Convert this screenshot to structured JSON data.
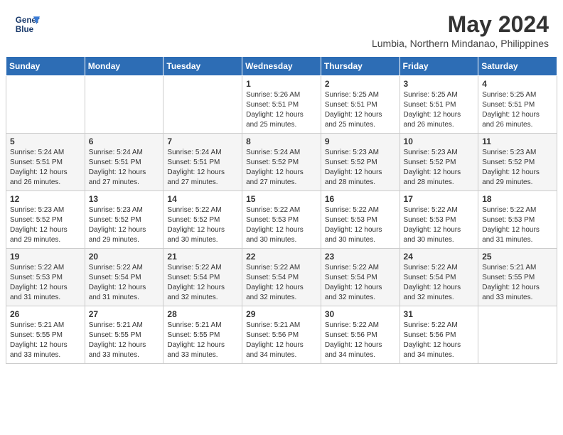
{
  "header": {
    "logo_line1": "General",
    "logo_line2": "Blue",
    "month": "May 2024",
    "location": "Lumbia, Northern Mindanao, Philippines"
  },
  "weekdays": [
    "Sunday",
    "Monday",
    "Tuesday",
    "Wednesday",
    "Thursday",
    "Friday",
    "Saturday"
  ],
  "weeks": [
    [
      {
        "day": "",
        "sunrise": "",
        "sunset": "",
        "daylight": ""
      },
      {
        "day": "",
        "sunrise": "",
        "sunset": "",
        "daylight": ""
      },
      {
        "day": "",
        "sunrise": "",
        "sunset": "",
        "daylight": ""
      },
      {
        "day": "1",
        "sunrise": "Sunrise: 5:26 AM",
        "sunset": "Sunset: 5:51 PM",
        "daylight": "Daylight: 12 hours and 25 minutes."
      },
      {
        "day": "2",
        "sunrise": "Sunrise: 5:25 AM",
        "sunset": "Sunset: 5:51 PM",
        "daylight": "Daylight: 12 hours and 25 minutes."
      },
      {
        "day": "3",
        "sunrise": "Sunrise: 5:25 AM",
        "sunset": "Sunset: 5:51 PM",
        "daylight": "Daylight: 12 hours and 26 minutes."
      },
      {
        "day": "4",
        "sunrise": "Sunrise: 5:25 AM",
        "sunset": "Sunset: 5:51 PM",
        "daylight": "Daylight: 12 hours and 26 minutes."
      }
    ],
    [
      {
        "day": "5",
        "sunrise": "Sunrise: 5:24 AM",
        "sunset": "Sunset: 5:51 PM",
        "daylight": "Daylight: 12 hours and 26 minutes."
      },
      {
        "day": "6",
        "sunrise": "Sunrise: 5:24 AM",
        "sunset": "Sunset: 5:51 PM",
        "daylight": "Daylight: 12 hours and 27 minutes."
      },
      {
        "day": "7",
        "sunrise": "Sunrise: 5:24 AM",
        "sunset": "Sunset: 5:51 PM",
        "daylight": "Daylight: 12 hours and 27 minutes."
      },
      {
        "day": "8",
        "sunrise": "Sunrise: 5:24 AM",
        "sunset": "Sunset: 5:52 PM",
        "daylight": "Daylight: 12 hours and 27 minutes."
      },
      {
        "day": "9",
        "sunrise": "Sunrise: 5:23 AM",
        "sunset": "Sunset: 5:52 PM",
        "daylight": "Daylight: 12 hours and 28 minutes."
      },
      {
        "day": "10",
        "sunrise": "Sunrise: 5:23 AM",
        "sunset": "Sunset: 5:52 PM",
        "daylight": "Daylight: 12 hours and 28 minutes."
      },
      {
        "day": "11",
        "sunrise": "Sunrise: 5:23 AM",
        "sunset": "Sunset: 5:52 PM",
        "daylight": "Daylight: 12 hours and 29 minutes."
      }
    ],
    [
      {
        "day": "12",
        "sunrise": "Sunrise: 5:23 AM",
        "sunset": "Sunset: 5:52 PM",
        "daylight": "Daylight: 12 hours and 29 minutes."
      },
      {
        "day": "13",
        "sunrise": "Sunrise: 5:23 AM",
        "sunset": "Sunset: 5:52 PM",
        "daylight": "Daylight: 12 hours and 29 minutes."
      },
      {
        "day": "14",
        "sunrise": "Sunrise: 5:22 AM",
        "sunset": "Sunset: 5:52 PM",
        "daylight": "Daylight: 12 hours and 30 minutes."
      },
      {
        "day": "15",
        "sunrise": "Sunrise: 5:22 AM",
        "sunset": "Sunset: 5:53 PM",
        "daylight": "Daylight: 12 hours and 30 minutes."
      },
      {
        "day": "16",
        "sunrise": "Sunrise: 5:22 AM",
        "sunset": "Sunset: 5:53 PM",
        "daylight": "Daylight: 12 hours and 30 minutes."
      },
      {
        "day": "17",
        "sunrise": "Sunrise: 5:22 AM",
        "sunset": "Sunset: 5:53 PM",
        "daylight": "Daylight: 12 hours and 30 minutes."
      },
      {
        "day": "18",
        "sunrise": "Sunrise: 5:22 AM",
        "sunset": "Sunset: 5:53 PM",
        "daylight": "Daylight: 12 hours and 31 minutes."
      }
    ],
    [
      {
        "day": "19",
        "sunrise": "Sunrise: 5:22 AM",
        "sunset": "Sunset: 5:53 PM",
        "daylight": "Daylight: 12 hours and 31 minutes."
      },
      {
        "day": "20",
        "sunrise": "Sunrise: 5:22 AM",
        "sunset": "Sunset: 5:54 PM",
        "daylight": "Daylight: 12 hours and 31 minutes."
      },
      {
        "day": "21",
        "sunrise": "Sunrise: 5:22 AM",
        "sunset": "Sunset: 5:54 PM",
        "daylight": "Daylight: 12 hours and 32 minutes."
      },
      {
        "day": "22",
        "sunrise": "Sunrise: 5:22 AM",
        "sunset": "Sunset: 5:54 PM",
        "daylight": "Daylight: 12 hours and 32 minutes."
      },
      {
        "day": "23",
        "sunrise": "Sunrise: 5:22 AM",
        "sunset": "Sunset: 5:54 PM",
        "daylight": "Daylight: 12 hours and 32 minutes."
      },
      {
        "day": "24",
        "sunrise": "Sunrise: 5:22 AM",
        "sunset": "Sunset: 5:54 PM",
        "daylight": "Daylight: 12 hours and 32 minutes."
      },
      {
        "day": "25",
        "sunrise": "Sunrise: 5:21 AM",
        "sunset": "Sunset: 5:55 PM",
        "daylight": "Daylight: 12 hours and 33 minutes."
      }
    ],
    [
      {
        "day": "26",
        "sunrise": "Sunrise: 5:21 AM",
        "sunset": "Sunset: 5:55 PM",
        "daylight": "Daylight: 12 hours and 33 minutes."
      },
      {
        "day": "27",
        "sunrise": "Sunrise: 5:21 AM",
        "sunset": "Sunset: 5:55 PM",
        "daylight": "Daylight: 12 hours and 33 minutes."
      },
      {
        "day": "28",
        "sunrise": "Sunrise: 5:21 AM",
        "sunset": "Sunset: 5:55 PM",
        "daylight": "Daylight: 12 hours and 33 minutes."
      },
      {
        "day": "29",
        "sunrise": "Sunrise: 5:21 AM",
        "sunset": "Sunset: 5:56 PM",
        "daylight": "Daylight: 12 hours and 34 minutes."
      },
      {
        "day": "30",
        "sunrise": "Sunrise: 5:22 AM",
        "sunset": "Sunset: 5:56 PM",
        "daylight": "Daylight: 12 hours and 34 minutes."
      },
      {
        "day": "31",
        "sunrise": "Sunrise: 5:22 AM",
        "sunset": "Sunset: 5:56 PM",
        "daylight": "Daylight: 12 hours and 34 minutes."
      },
      {
        "day": "",
        "sunrise": "",
        "sunset": "",
        "daylight": ""
      }
    ]
  ]
}
